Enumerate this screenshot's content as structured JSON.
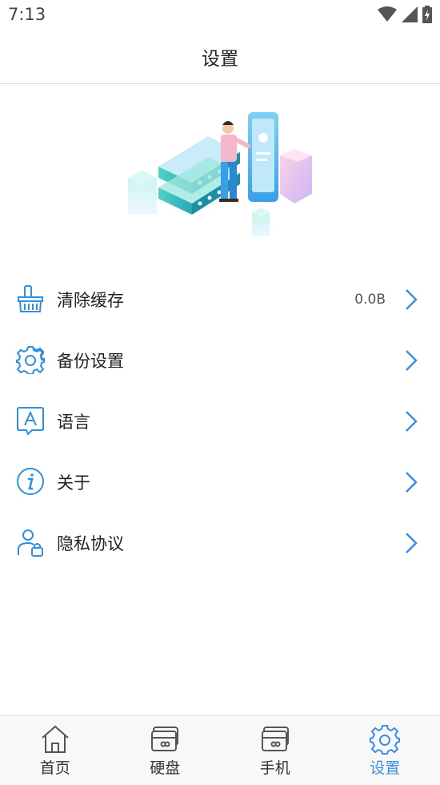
{
  "status_bar": {
    "time": "7:13"
  },
  "header": {
    "title": "设置"
  },
  "colors": {
    "accent": "#3a8ee6",
    "icon_blue": "#2f8fe0"
  },
  "menu": {
    "items": [
      {
        "label": "清除缓存",
        "value": "0.0B",
        "icon": "basket-icon"
      },
      {
        "label": "备份设置",
        "value": "",
        "icon": "gear-icon"
      },
      {
        "label": "语言",
        "value": "",
        "icon": "language-icon"
      },
      {
        "label": "关于",
        "value": "",
        "icon": "info-icon"
      },
      {
        "label": "隐私协议",
        "value": "",
        "icon": "user-lock-icon"
      }
    ]
  },
  "tabbar": {
    "tabs": [
      {
        "label": "首页",
        "icon": "home-icon",
        "active": false
      },
      {
        "label": "硬盘",
        "icon": "disk-icon",
        "active": false
      },
      {
        "label": "手机",
        "icon": "phone-card-icon",
        "active": false
      },
      {
        "label": "设置",
        "icon": "gear-icon",
        "active": true
      }
    ]
  }
}
